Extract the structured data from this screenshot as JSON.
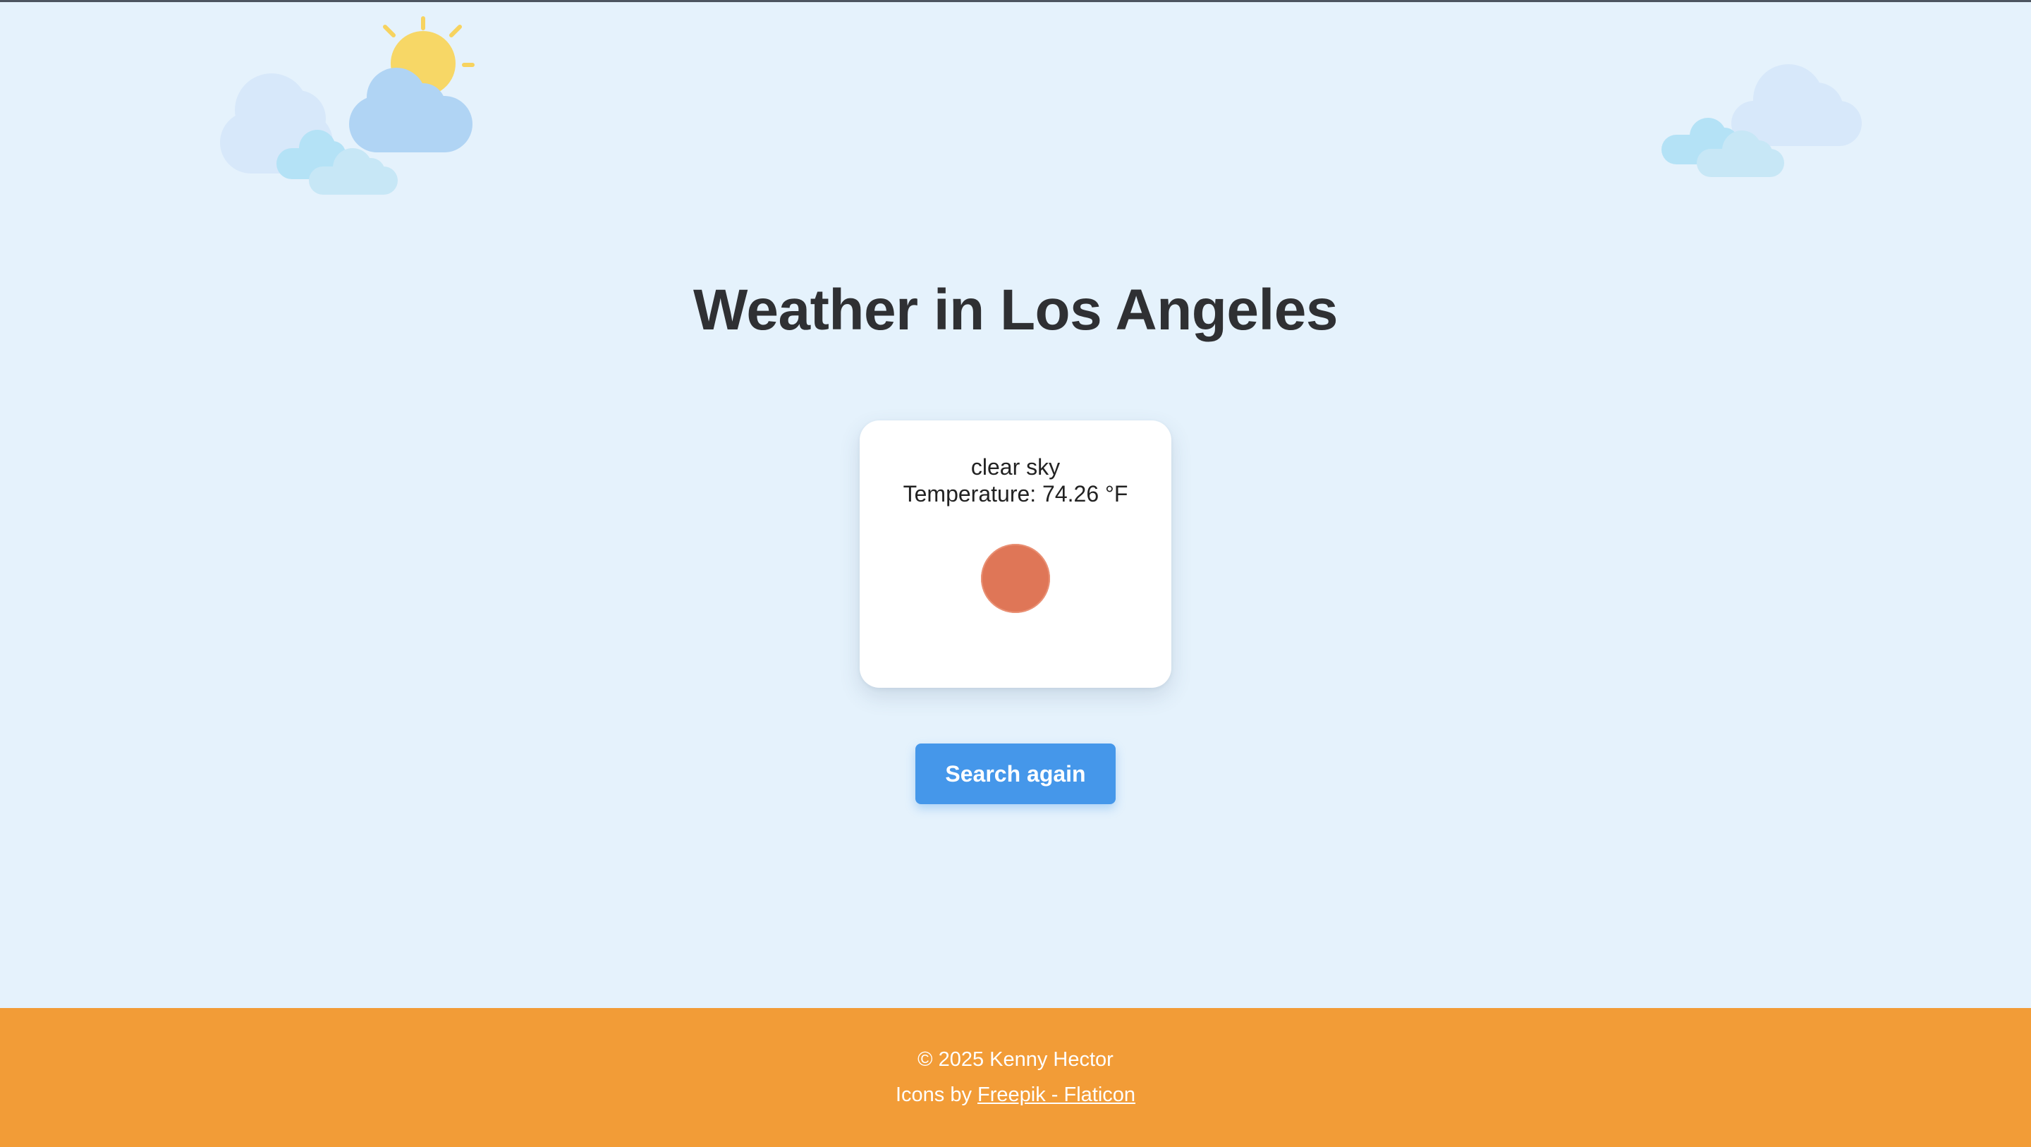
{
  "page": {
    "title": "Weather in Los Angeles"
  },
  "weather": {
    "description": "clear sky",
    "temperature_text": "Temperature: 74.26 °F",
    "icon": "sun-icon"
  },
  "actions": {
    "search_again_label": "Search again"
  },
  "footer": {
    "copyright": "© 2025 Kenny Hector",
    "credit_prefix": "Icons by ",
    "credit_link_label": "Freepik - Flaticon"
  },
  "decorations": {
    "left_icon": "sun-behind-clouds-icon",
    "right_icon": "clouds-icon"
  },
  "colors": {
    "background": "#e5f2fc",
    "footer": "#f29c37",
    "button": "#4597ea",
    "sun": "#df7657"
  }
}
